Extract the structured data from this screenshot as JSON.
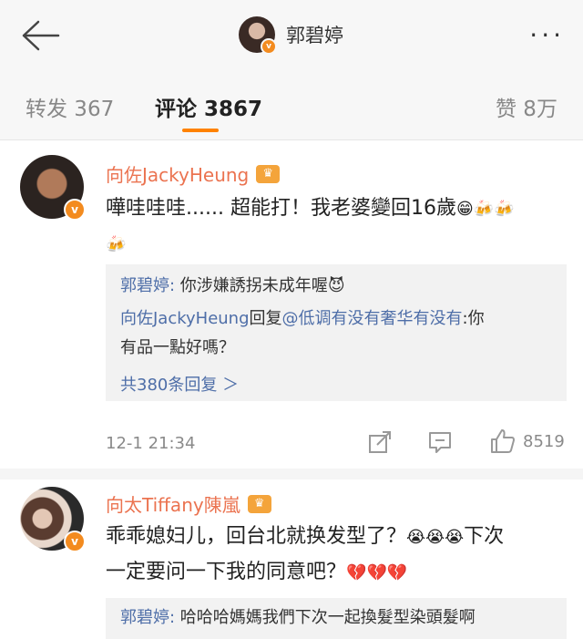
{
  "header": {
    "back_icon": "back-arrow-icon",
    "title": "郭碧婷",
    "more": "···"
  },
  "tabs": [
    {
      "label": "转发 367"
    },
    {
      "label": "评论 3867"
    },
    {
      "label": "赞 8万"
    }
  ],
  "comments": [
    {
      "author": "向佐JackyHeung",
      "badge_icon": "crown-icon",
      "text_line1": "嘩哇哇哇...... 超能打！我老婆變回16歲",
      "text_line2_emoji": "🍻",
      "emojis_line1": [
        "😁",
        "🍻",
        "🍻"
      ],
      "replies": [
        {
          "author": "郭碧婷:",
          "text": " 你涉嫌誘拐未成年喔",
          "emoji": "😈"
        },
        {
          "author": "向佐JackyHeung",
          "verb": "回复",
          "mention": "@低调有没有奢华有没有",
          "text": ":你",
          "text2": "有品一點好嗎？"
        }
      ],
      "more_replies": "共380条回复 ＞",
      "time": "12-1 21:34",
      "like_count": "8519"
    },
    {
      "author": "向太Tiffany陳嵐",
      "badge_icon": "crown-icon",
      "text_line1": "乖乖媳妇儿，回台北就换发型了？",
      "emojis_line1": [
        "😭",
        "😭",
        "😭"
      ],
      "text_line1_tail": "下次",
      "text_line2": "一定要问一下我的同意吧？",
      "emojis_line2": [
        "💔",
        "💔",
        "💔"
      ],
      "replies": [
        {
          "author": "郭碧婷:",
          "text": " 哈哈哈媽媽我們下次一起換髮型染頭髮啊"
        }
      ]
    }
  ]
}
